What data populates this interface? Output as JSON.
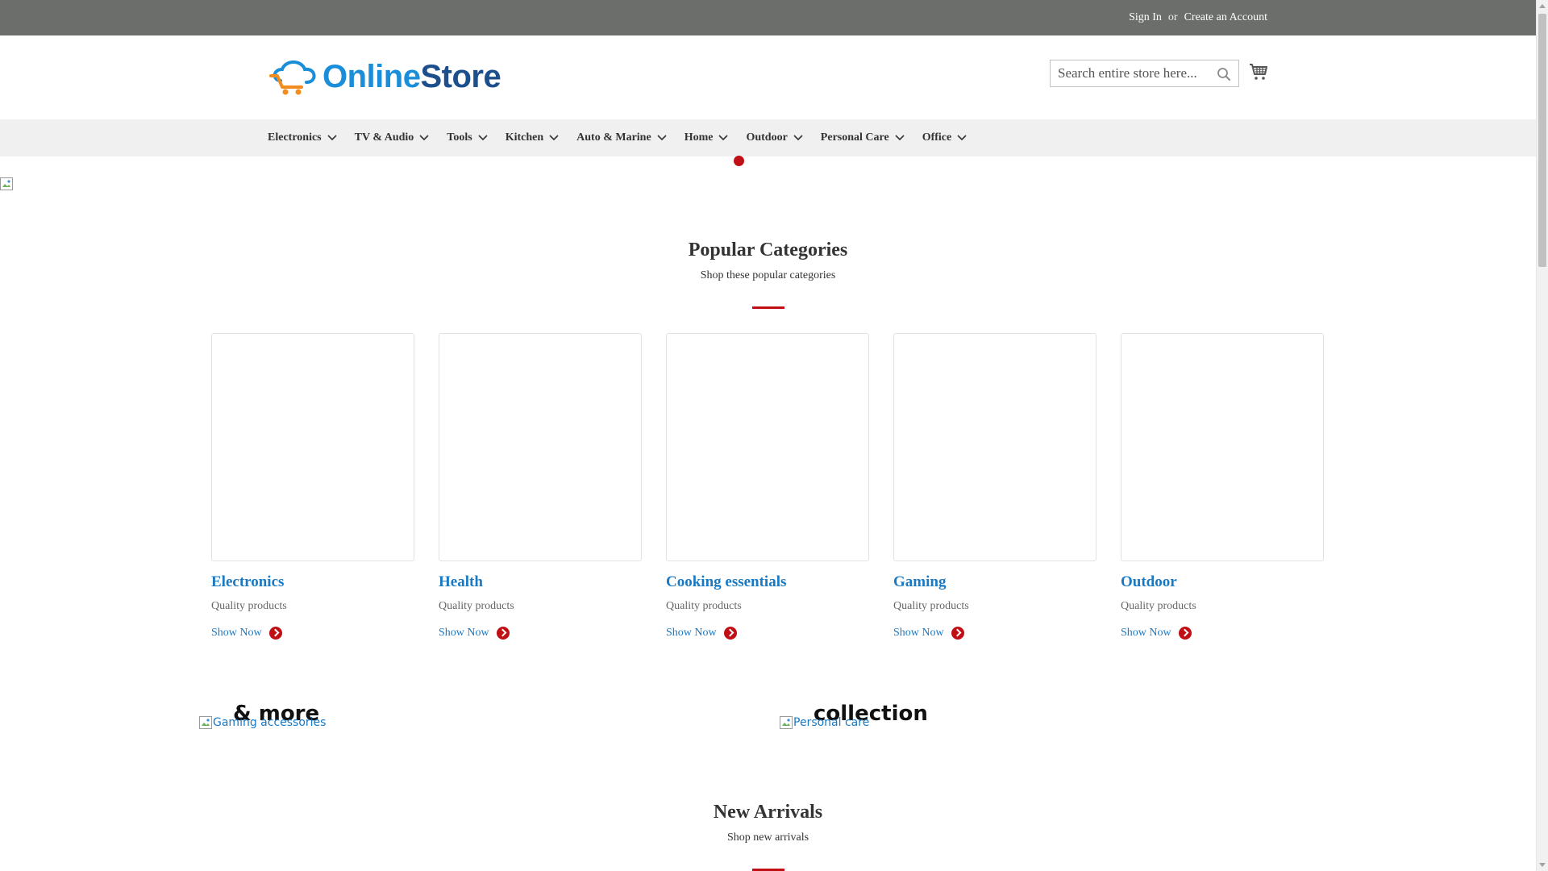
{
  "topbar": {
    "sign_in": "Sign In",
    "or": "or",
    "create_account": "Create an Account"
  },
  "header": {
    "logo_part1": "Online",
    "logo_part2": "Store",
    "search_placeholder": "Search entire store here..."
  },
  "nav": {
    "items": [
      {
        "label": "Electronics"
      },
      {
        "label": "TV & Audio"
      },
      {
        "label": "Tools"
      },
      {
        "label": "Kitchen"
      },
      {
        "label": "Auto & Marine"
      },
      {
        "label": "Home"
      },
      {
        "label": "Outdoor"
      },
      {
        "label": "Personal Care"
      },
      {
        "label": "Office"
      }
    ]
  },
  "popular": {
    "title": "Popular Categories",
    "subtitle": "Shop these popular categories",
    "cards": [
      {
        "title": "Electronics",
        "subtitle": "Quality products",
        "link": "Show Now"
      },
      {
        "title": "Health",
        "subtitle": "Quality products",
        "link": "Show Now"
      },
      {
        "title": "Cooking essentials",
        "subtitle": "Quality products",
        "link": "Show Now"
      },
      {
        "title": "Gaming",
        "subtitle": "Quality products",
        "link": "Show Now"
      },
      {
        "title": "Outdoor",
        "subtitle": "Quality products",
        "link": "Show Now"
      }
    ]
  },
  "banners": {
    "left_text": "& more",
    "left_alt": "Gaming accessories",
    "right_text": "collection",
    "right_alt": "Personal care"
  },
  "new_arrivals": {
    "title": "New Arrivals",
    "subtitle": "Shop new arrivals"
  },
  "colors": {
    "accent_red": "#c01016",
    "link_blue": "#1979c3",
    "topbar_gray": "#6b6e6b",
    "nav_bg": "#f0f0f0"
  }
}
